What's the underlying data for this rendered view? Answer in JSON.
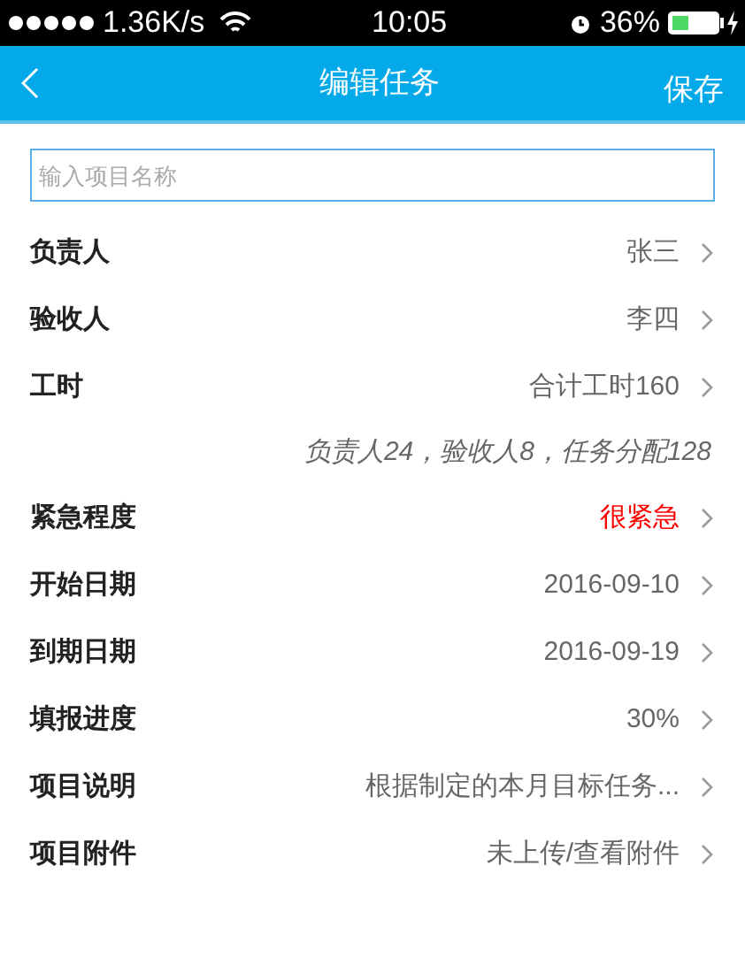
{
  "status_bar": {
    "speed": "1.36K/s",
    "time": "10:05",
    "battery": "36%"
  },
  "nav": {
    "title": "编辑任务",
    "action": "保存"
  },
  "name_field": {
    "placeholder": "输入项目名称"
  },
  "rows": [
    {
      "kind": "field",
      "label": "负责人",
      "value": "张三",
      "color": "#666666"
    },
    {
      "kind": "field",
      "label": "验收人",
      "value": "李四",
      "color": "#666666"
    },
    {
      "kind": "field",
      "label": "工时",
      "value": "合计工时160",
      "color": "#666666"
    },
    {
      "kind": "note",
      "value": "负责人24，验收人8，任务分配128"
    },
    {
      "kind": "field",
      "label": "紧急程度",
      "value": "很紧急",
      "color": "#ff0000"
    },
    {
      "kind": "field",
      "label": "开始日期",
      "value": "2016-09-10",
      "color": "#666666"
    },
    {
      "kind": "field",
      "label": "到期日期",
      "value": "2016-09-19",
      "color": "#666666"
    },
    {
      "kind": "field",
      "label": "填报进度",
      "value": "30%",
      "color": "#666666"
    },
    {
      "kind": "field",
      "label": "项目说明",
      "value": "根据制定的本月目标任务...",
      "color": "#666666"
    },
    {
      "kind": "field",
      "label": "项目附件",
      "value": "未上传/查看附件",
      "color": "#666666"
    }
  ]
}
